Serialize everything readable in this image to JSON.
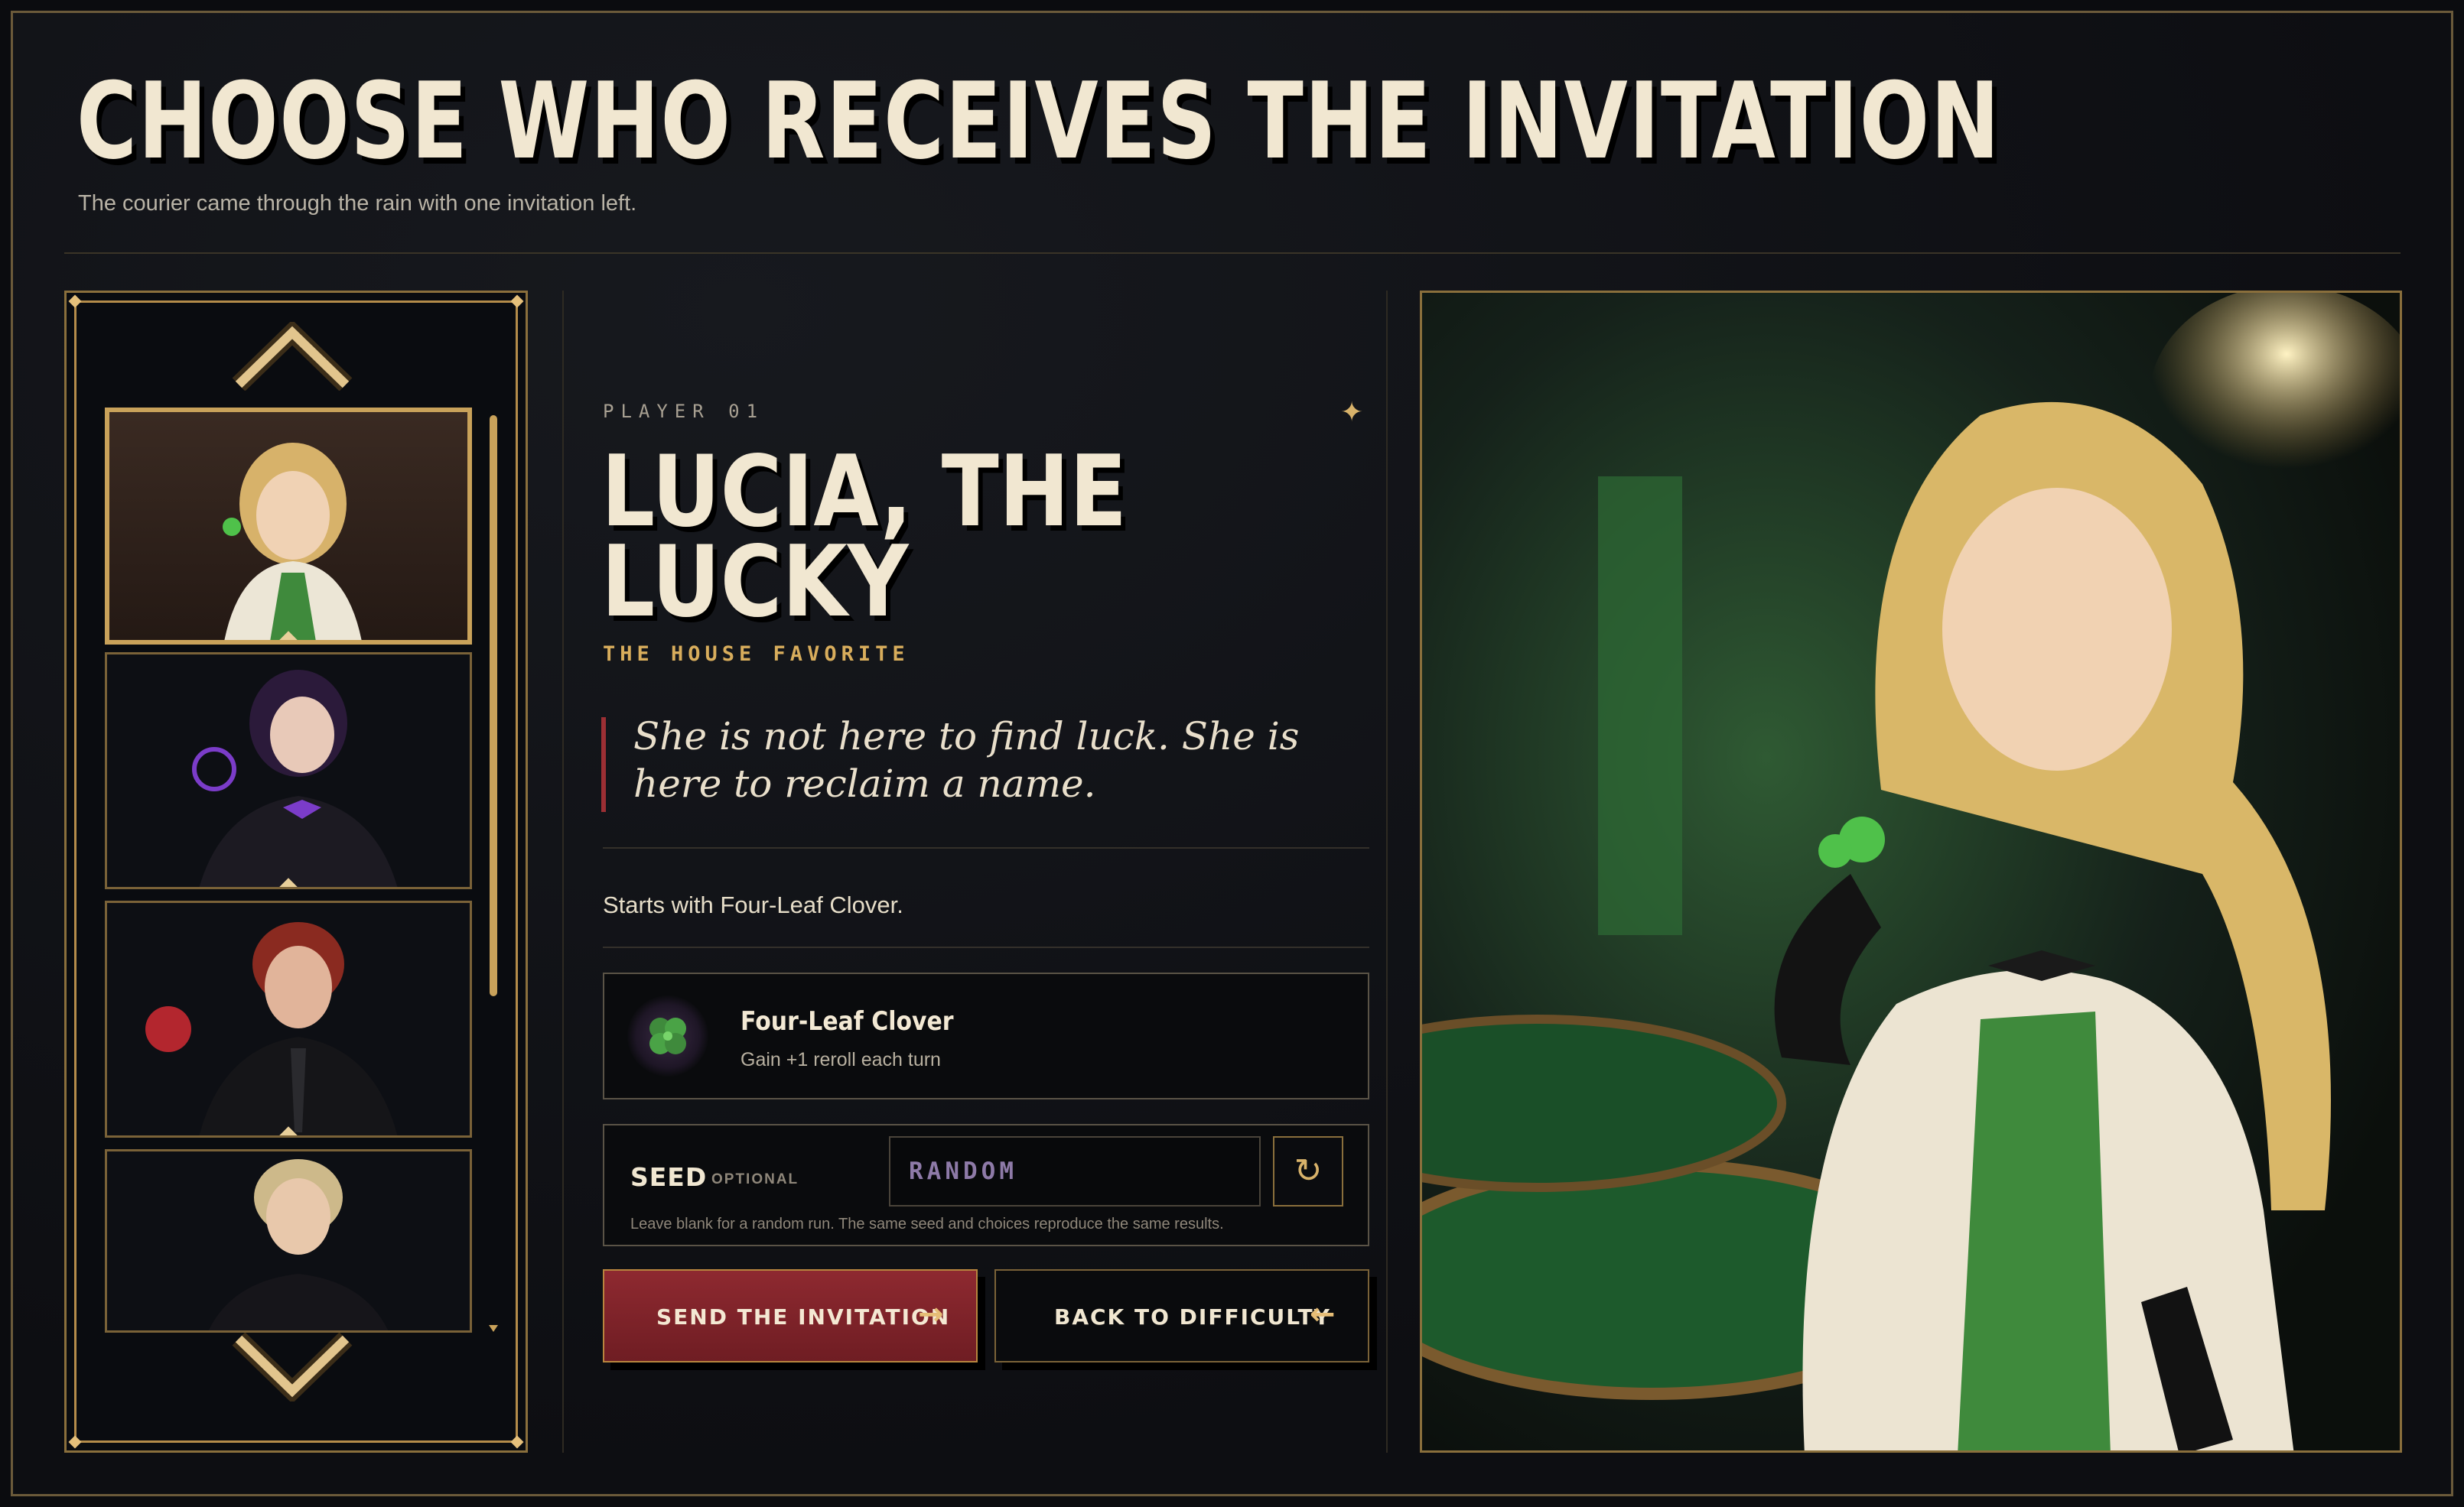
{
  "header": {
    "title": "CHOOSE WHO RECEIVES THE INVITATION",
    "subtitle": "The courier came through the rain with one invitation left."
  },
  "carousel": {
    "up_icon": "chevron-up-icon",
    "down_icon": "chevron-down-icon",
    "characters": [
      {
        "name": "Lucia, The Lucky",
        "accent": "#3f8a3c",
        "selected": true
      },
      {
        "name": "Purple-haired character",
        "accent": "#7b3cc9",
        "selected": false
      },
      {
        "name": "Red-haired character",
        "accent": "#b3262e",
        "selected": false
      },
      {
        "name": "Blond character",
        "accent": "#9a8a6a",
        "selected": false
      }
    ]
  },
  "details": {
    "player_label": "PLAYER 01",
    "name": "LUCIA, THE LUCKY",
    "tagline": "THE HOUSE FAVORITE",
    "quote": "She is not here to find luck. She is here to reclaim a name.",
    "starts_with": "Starts with Four-Leaf Clover.",
    "item": {
      "icon": "clover-icon",
      "name": "Four-Leaf Clover",
      "description": "Gain +1 reroll each turn"
    },
    "seed": {
      "label": "SEED",
      "optional": "OPTIONAL",
      "placeholder": "RANDOM",
      "reroll_icon": "refresh-icon",
      "help": "Leave blank for a random run. The same seed and choices reproduce the same results."
    },
    "buttons": {
      "primary": "SEND THE INVITATION",
      "secondary": "BACK TO DIFFICULTY"
    }
  },
  "colors": {
    "gold": "#c9a25a",
    "crimson": "#8e2930",
    "cream": "#f1e7d1",
    "clover_green": "#3f8a3c"
  }
}
